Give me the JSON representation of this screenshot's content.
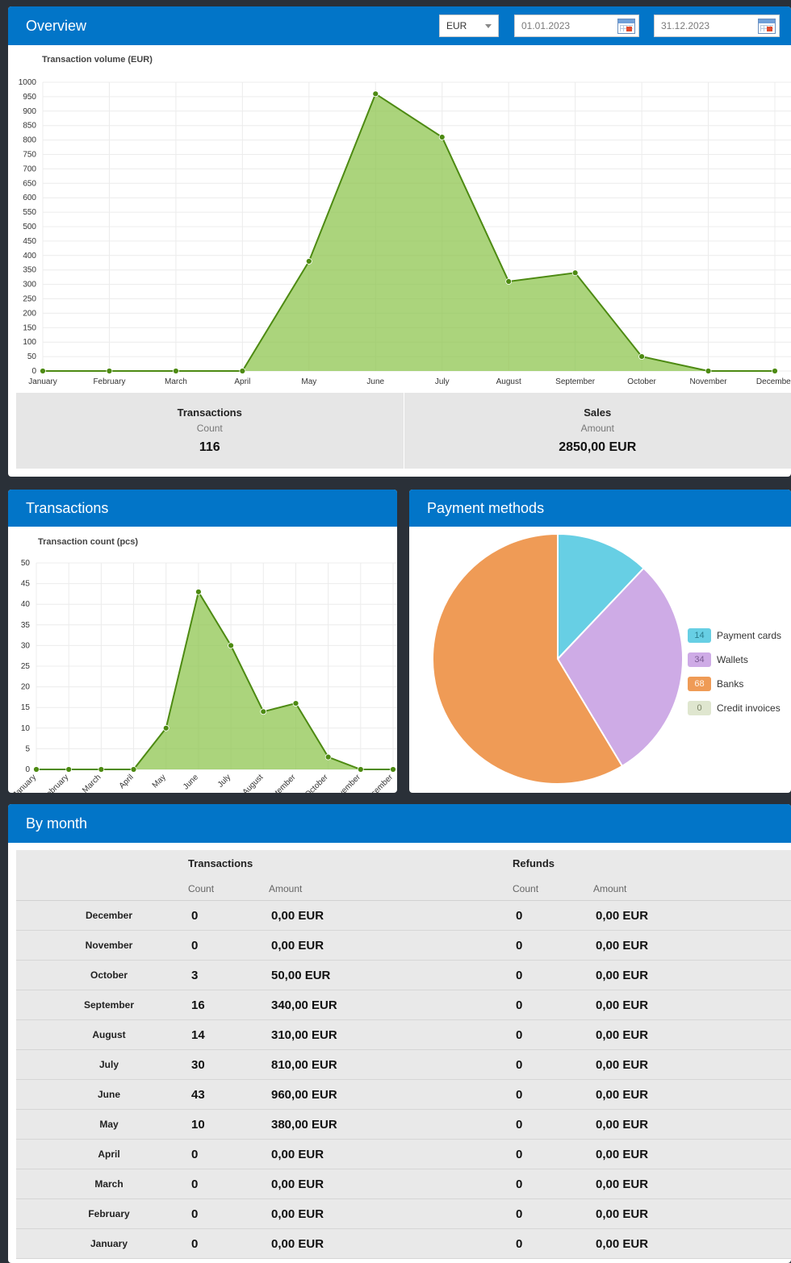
{
  "overview": {
    "title": "Overview",
    "currency": "EUR",
    "date_from": "01.01.2023",
    "date_to": "31.12.2023",
    "chart_title": "Transaction volume (EUR)",
    "stats": {
      "transactions": {
        "title": "Transactions",
        "sub": "Count",
        "value": "116"
      },
      "sales": {
        "title": "Sales",
        "sub": "Amount",
        "value": "2850,00 EUR"
      }
    }
  },
  "transactions": {
    "title": "Transactions",
    "chart_title": "Transaction count (pcs)"
  },
  "payments": {
    "title": "Payment methods",
    "legend": [
      {
        "count": "14",
        "label": "Payment cards",
        "color": "#67cfe4"
      },
      {
        "count": "34",
        "label": "Wallets",
        "color": "#ceabe6"
      },
      {
        "count": "68",
        "label": "Banks",
        "color": "#ef9b56"
      },
      {
        "count": "0",
        "label": "Credit invoices",
        "color": "#dfe6cf"
      }
    ]
  },
  "by_month": {
    "title": "By month",
    "group_transactions": "Transactions",
    "group_refunds": "Refunds",
    "col_count": "Count",
    "col_amount": "Amount",
    "rows": [
      {
        "month": "December",
        "t_count": "0",
        "t_amount": "0,00 EUR",
        "r_count": "0",
        "r_amount": "0,00 EUR"
      },
      {
        "month": "November",
        "t_count": "0",
        "t_amount": "0,00 EUR",
        "r_count": "0",
        "r_amount": "0,00 EUR"
      },
      {
        "month": "October",
        "t_count": "3",
        "t_amount": "50,00 EUR",
        "r_count": "0",
        "r_amount": "0,00 EUR"
      },
      {
        "month": "September",
        "t_count": "16",
        "t_amount": "340,00 EUR",
        "r_count": "0",
        "r_amount": "0,00 EUR"
      },
      {
        "month": "August",
        "t_count": "14",
        "t_amount": "310,00 EUR",
        "r_count": "0",
        "r_amount": "0,00 EUR"
      },
      {
        "month": "July",
        "t_count": "30",
        "t_amount": "810,00 EUR",
        "r_count": "0",
        "r_amount": "0,00 EUR"
      },
      {
        "month": "June",
        "t_count": "43",
        "t_amount": "960,00 EUR",
        "r_count": "0",
        "r_amount": "0,00 EUR"
      },
      {
        "month": "May",
        "t_count": "10",
        "t_amount": "380,00 EUR",
        "r_count": "0",
        "r_amount": "0,00 EUR"
      },
      {
        "month": "April",
        "t_count": "0",
        "t_amount": "0,00 EUR",
        "r_count": "0",
        "r_amount": "0,00 EUR"
      },
      {
        "month": "March",
        "t_count": "0",
        "t_amount": "0,00 EUR",
        "r_count": "0",
        "r_amount": "0,00 EUR"
      },
      {
        "month": "February",
        "t_count": "0",
        "t_amount": "0,00 EUR",
        "r_count": "0",
        "r_amount": "0,00 EUR"
      },
      {
        "month": "January",
        "t_count": "0",
        "t_amount": "0,00 EUR",
        "r_count": "0",
        "r_amount": "0,00 EUR"
      }
    ]
  },
  "chart_data": [
    {
      "type": "area",
      "title": "Transaction volume (EUR)",
      "categories": [
        "January",
        "February",
        "March",
        "April",
        "May",
        "June",
        "July",
        "August",
        "September",
        "October",
        "November",
        "December"
      ],
      "values": [
        0,
        0,
        0,
        0,
        380,
        960,
        810,
        310,
        340,
        50,
        0,
        0
      ],
      "ylim": [
        0,
        1000
      ],
      "ytick_step": 50,
      "grid": true,
      "color": "#8bc34a"
    },
    {
      "type": "area",
      "title": "Transaction count (pcs)",
      "categories": [
        "January",
        "February",
        "March",
        "April",
        "May",
        "June",
        "July",
        "August",
        "September",
        "October",
        "November",
        "December"
      ],
      "values": [
        0,
        0,
        0,
        0,
        10,
        43,
        30,
        14,
        16,
        3,
        0,
        0
      ],
      "ylim": [
        0,
        50
      ],
      "ytick_step": 5,
      "grid": true,
      "color": "#8bc34a"
    },
    {
      "type": "pie",
      "labels": [
        "Payment cards",
        "Wallets",
        "Banks",
        "Credit invoices"
      ],
      "values": [
        14,
        34,
        68,
        0
      ],
      "colors": [
        "#67cfe4",
        "#ceabe6",
        "#ef9b56",
        "#dfe6cf"
      ],
      "legend": "right"
    }
  ]
}
